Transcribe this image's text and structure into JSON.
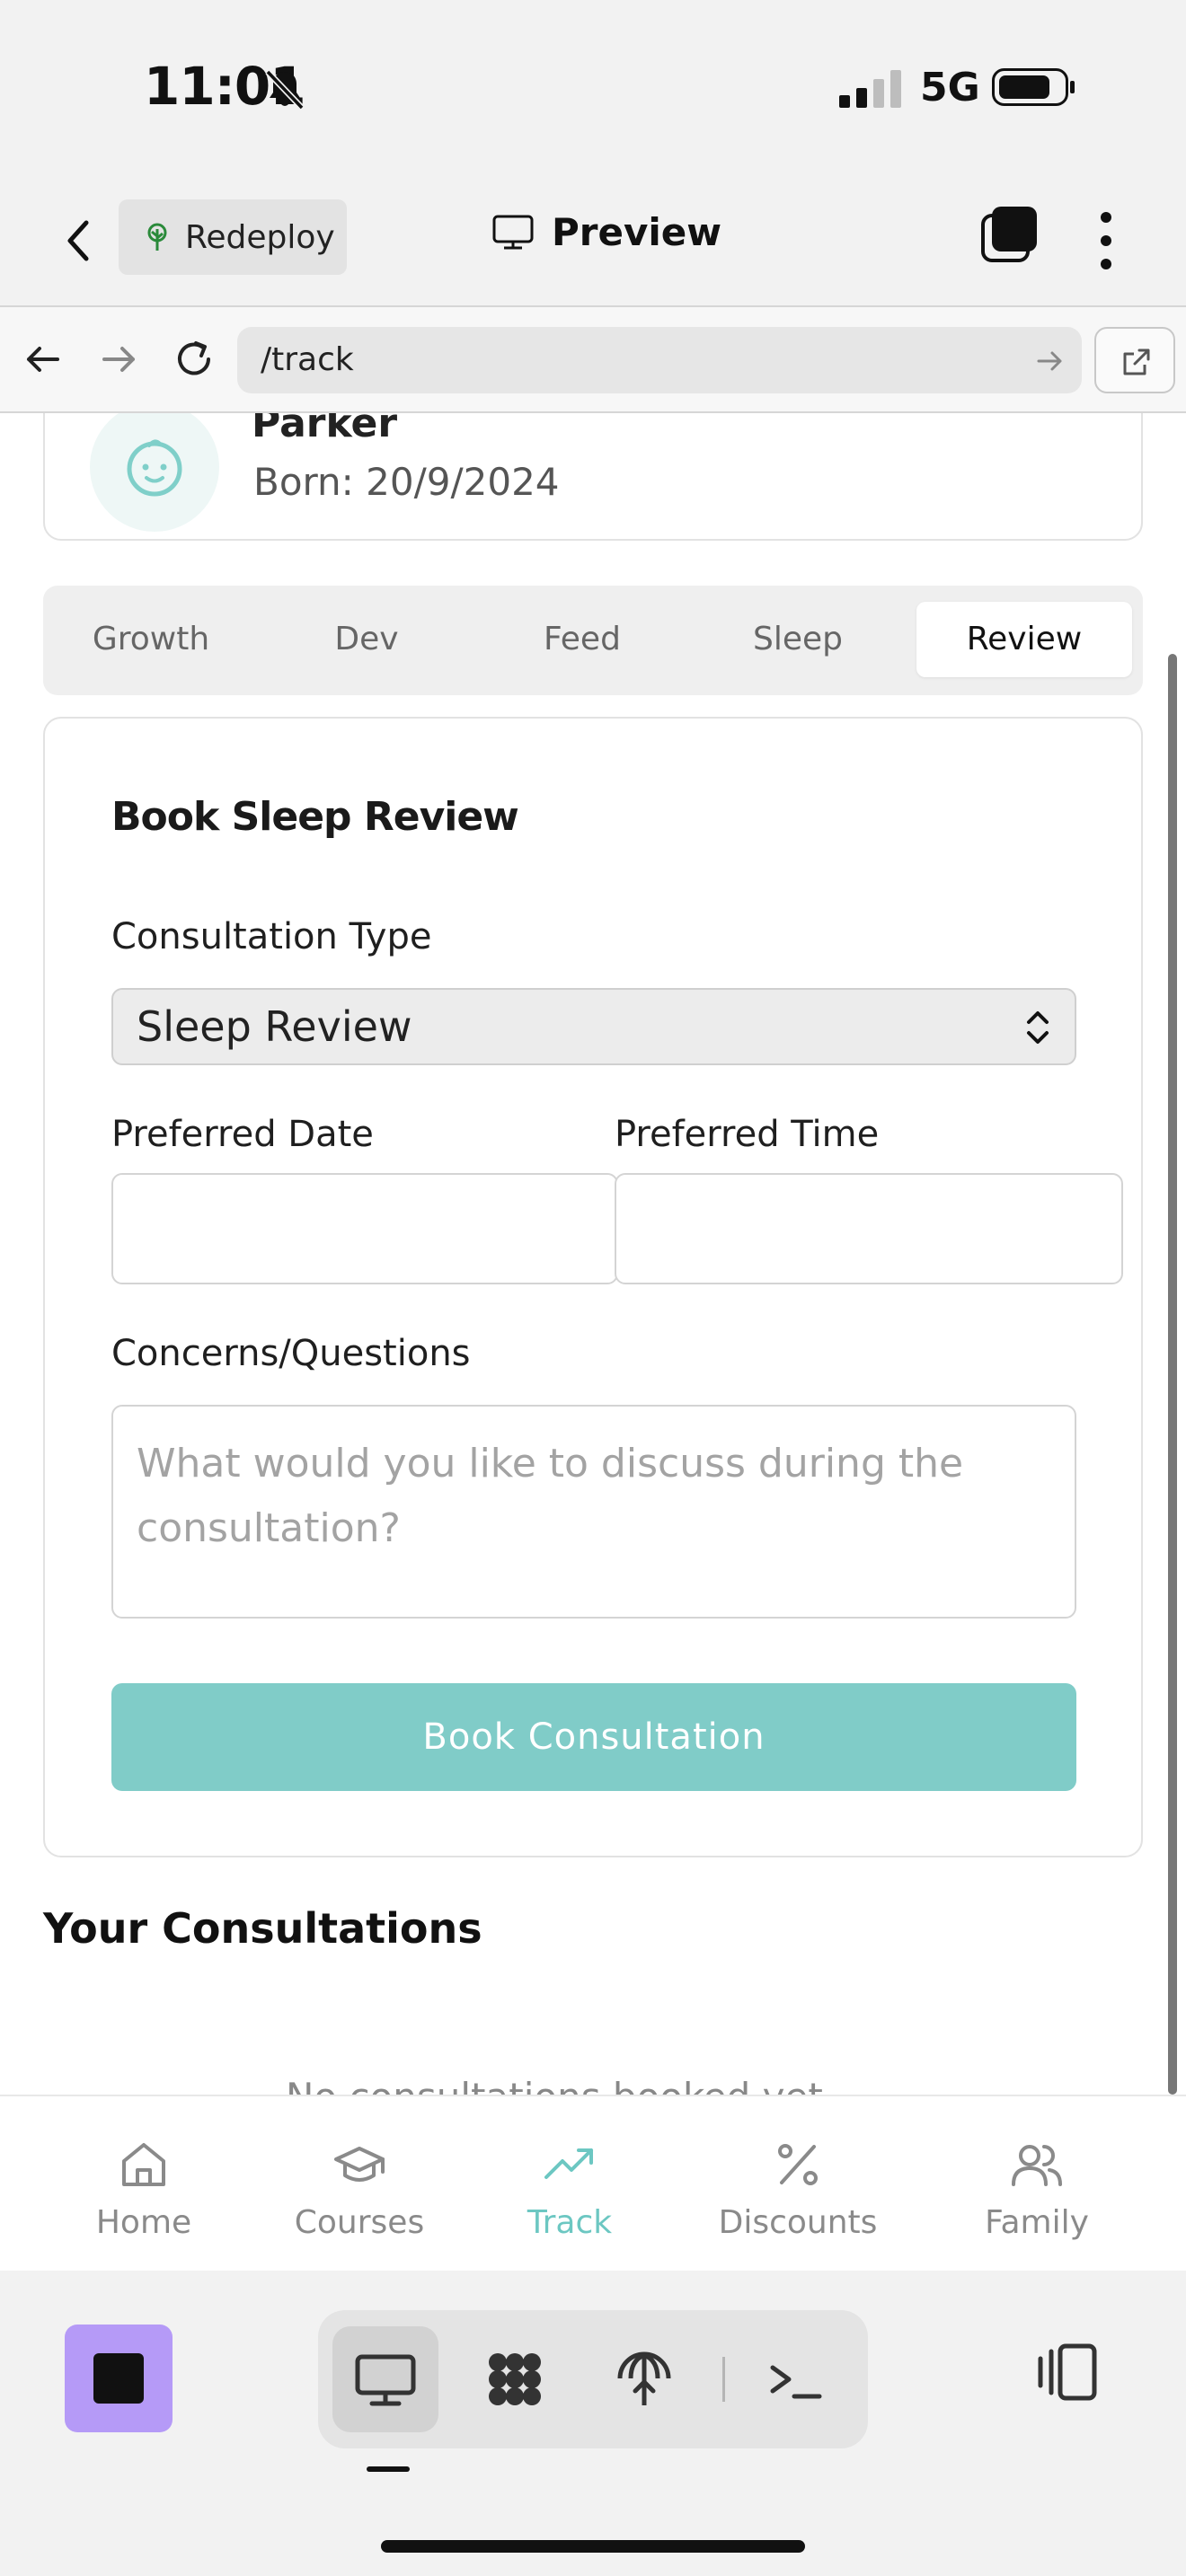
{
  "status_bar": {
    "time": "11:01",
    "network": "5G",
    "battery_level": 0.8
  },
  "header": {
    "redeploy_label": "Redeploy",
    "title": "Preview"
  },
  "browser": {
    "url": "/track"
  },
  "child": {
    "name": "Parker",
    "born": "Born: 20/9/2024"
  },
  "tabs": [
    {
      "label": "Growth",
      "active": false
    },
    {
      "label": "Dev",
      "active": false
    },
    {
      "label": "Feed",
      "active": false
    },
    {
      "label": "Sleep",
      "active": false
    },
    {
      "label": "Review",
      "active": true
    }
  ],
  "form": {
    "title": "Book Sleep Review",
    "consultation_type_label": "Consultation Type",
    "consultation_type_value": "Sleep Review",
    "preferred_date_label": "Preferred Date",
    "preferred_time_label": "Preferred Time",
    "concerns_label": "Concerns/Questions",
    "concerns_placeholder": "What would you like to discuss during the consultation?",
    "submit_label": "Book Consultation"
  },
  "consultations": {
    "title": "Your Consultations",
    "empty_text": "No consultations booked yet"
  },
  "bottom_nav": [
    {
      "label": "Home",
      "icon": "home-icon",
      "active": false
    },
    {
      "label": "Courses",
      "icon": "graduation-cap-icon",
      "active": false
    },
    {
      "label": "Track",
      "icon": "trending-up-icon",
      "active": true
    },
    {
      "label": "Discounts",
      "icon": "percent-icon",
      "active": false
    },
    {
      "label": "Family",
      "icon": "users-icon",
      "active": false
    }
  ],
  "dev_toolbar": {
    "tools": [
      {
        "icon": "monitor-icon",
        "active": true
      },
      {
        "icon": "workflow-icon",
        "active": false
      },
      {
        "icon": "deploy-icon",
        "active": false
      },
      {
        "icon": "terminal-icon",
        "active": false
      }
    ]
  },
  "colors": {
    "accent": "#6cc7c2",
    "button": "#80ccc8",
    "stop_button": "#b59af7"
  }
}
